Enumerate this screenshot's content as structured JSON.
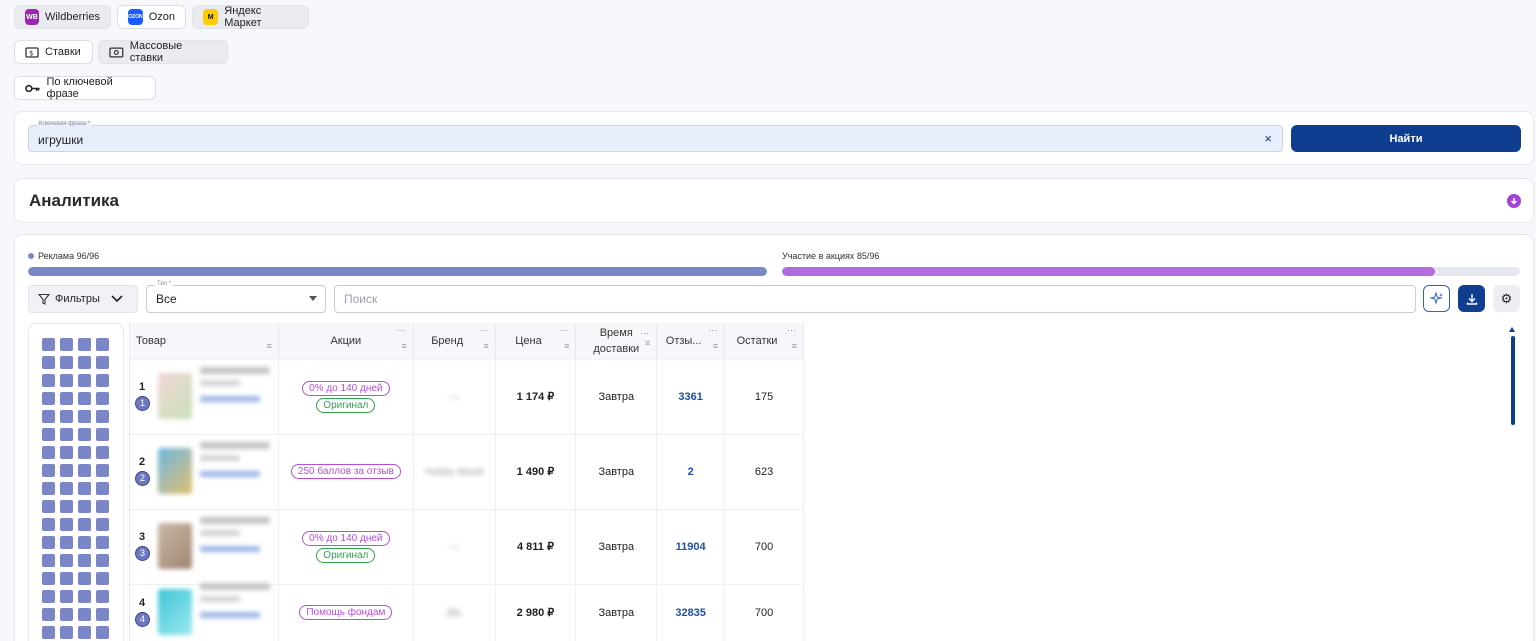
{
  "marketplaces": [
    {
      "label": "Wildberries",
      "logo": "WB",
      "color": "#9b27b0",
      "active": true
    },
    {
      "label": "Ozon",
      "logo": "OZON",
      "color": "#1a5cff",
      "active": false
    },
    {
      "label": "Яндекс Маркет",
      "logo": "M",
      "color": "#ffcc00",
      "active": true
    }
  ],
  "modes": {
    "bids": "Ставки",
    "mass_bids": "Массовые ставки"
  },
  "keyword_tab": "По ключевой фразе",
  "search_form": {
    "field_label": "Ключевая фраза *",
    "value": "игрушки",
    "submit": "Найти"
  },
  "analytics": {
    "title": "Аналитика"
  },
  "stats": {
    "ads": {
      "label": "Реклама 96/96",
      "fraction": 1.0,
      "color": "#7b86c6"
    },
    "promos": {
      "label": "Участие в акциях 85/96",
      "fraction": 0.885,
      "color": "#b36be0"
    }
  },
  "toolbar": {
    "filters": "Фильтры",
    "type_label": "Тип *",
    "type_value": "Все",
    "search_placeholder": "Поиск"
  },
  "table": {
    "headers": {
      "product": "Товар",
      "promos": "Акции",
      "brand": "Бренд",
      "price": "Цена",
      "delivery_1": "Время",
      "delivery_2": "доставки",
      "reviews": "Отзы...",
      "stock": "Остатки"
    },
    "rows": [
      {
        "num": "1",
        "badge": "1",
        "promos": [
          "0% до 140 дней",
          "Оригинал"
        ],
        "brand": "—",
        "price": "1 174 ₽",
        "delivery": "Завтра",
        "reviews": "3361",
        "stock": "175"
      },
      {
        "num": "2",
        "badge": "2",
        "promos": [
          "250 баллов за отзыв"
        ],
        "brand": "Hobby World",
        "price": "1 490 ₽",
        "delivery": "Завтра",
        "reviews": "2",
        "stock": "623"
      },
      {
        "num": "3",
        "badge": "3",
        "promos": [
          "0% до 140 дней",
          "Оригинал"
        ],
        "brand": "—",
        "price": "4 811 ₽",
        "delivery": "Завтра",
        "reviews": "11904",
        "stock": "700"
      },
      {
        "num": "4",
        "badge": "4",
        "promos": [
          "Помощь фондам"
        ],
        "brand": "JBL",
        "price": "2 980 ₽",
        "delivery": "Завтра",
        "reviews": "32835",
        "stock": "700"
      }
    ]
  }
}
